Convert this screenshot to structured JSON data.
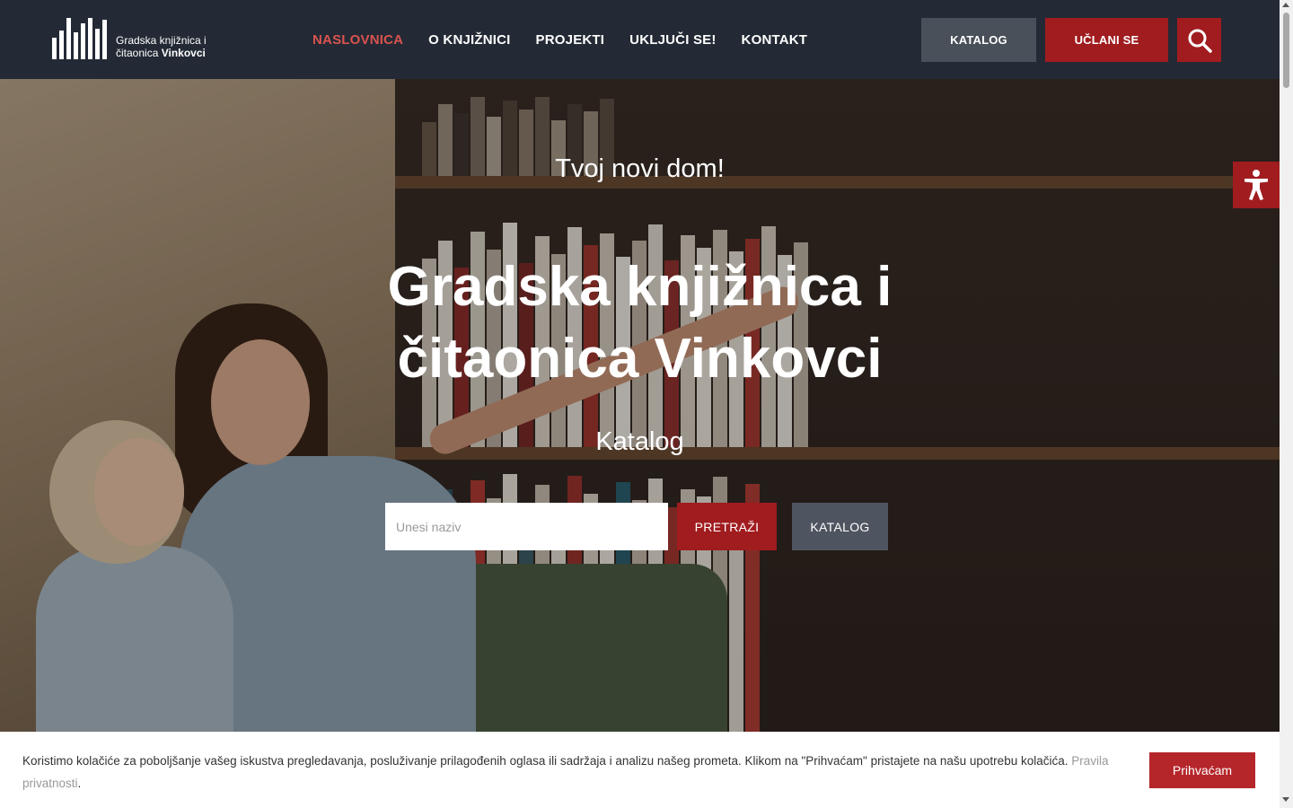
{
  "header": {
    "logo": {
      "line1": "Gradska knjižnica i",
      "line2_regular": "čitaonica ",
      "line2_bold": "Vinkovci"
    },
    "nav": [
      {
        "label": "NASLOVNICA",
        "active": true
      },
      {
        "label": "O KNJIŽNICI",
        "active": false
      },
      {
        "label": "PROJEKTI",
        "active": false
      },
      {
        "label": "UKLJUČI SE!",
        "active": false
      },
      {
        "label": "KONTAKT",
        "active": false
      }
    ],
    "katalog_button": "KATALOG",
    "join_button": "UČLANI SE",
    "search_icon": "search-icon"
  },
  "hero": {
    "subtitle": "Tvoj novi dom!",
    "title_line1": "Gradska knjižnica i",
    "title_line2": "čitaonica Vinkovci",
    "section_label": "Katalog",
    "search": {
      "placeholder": "Unesi naziv",
      "value": ""
    },
    "search_button": "PRETRAŽI",
    "catalog_button": "KATALOG"
  },
  "accessibility": {
    "icon": "accessibility-icon"
  },
  "cookie_bar": {
    "text": "Koristimo kolačiće za poboljšanje vašeg iskustva pregledavanja, posluživanje prilagođenih oglasa ili sadržaja i analizu našeg prometa. Klikom na \"Prihvaćam\" pristajete na našu upotrebu kolačića.",
    "link": "Pravila privatnosti",
    "link_suffix": ".",
    "accept_button": "Prihvaćam"
  },
  "colors": {
    "header_bg": "#232a35",
    "accent_red": "#a01c1f",
    "nav_active": "#d9534f",
    "gray_button": "#4a505a"
  }
}
